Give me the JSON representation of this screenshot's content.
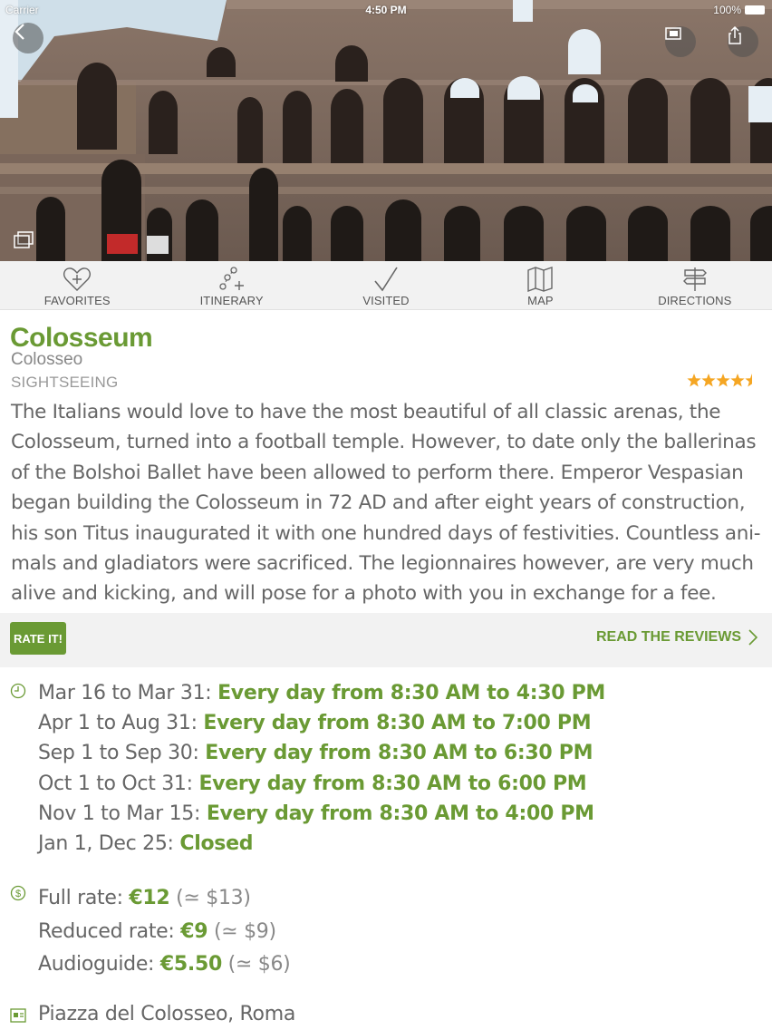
{
  "status_bar": {
    "carrier": "Carrier",
    "time": "4:50 PM",
    "battery": "100%"
  },
  "hero": {
    "image": "Colosseum photo"
  },
  "toolbar": {
    "items": [
      {
        "label": "FAVORITES",
        "icon": "heart-plus-icon"
      },
      {
        "label": "ITINERARY",
        "icon": "itinerary-icon"
      },
      {
        "label": "VISITED",
        "icon": "checkmark-icon"
      },
      {
        "label": "MAP",
        "icon": "map-icon"
      },
      {
        "label": "DIRECTIONS",
        "icon": "signpost-icon"
      }
    ]
  },
  "place": {
    "name": "Colosseum",
    "local_name": "Colosseo",
    "category": "SIGHTSEEING",
    "rating": 4.5,
    "description": "The Italians would love to have the most beautiful of all classic arenas, the Colosseum, turned into a football temple. However, to date only the ballerinas of the Bolshoi Ballet have been allowed to perform there. Emperor Vespasian began building the Colosseum in 72 AD and after eight years of construction, his son Titus inaugurated it with one hundred days of festivities. Countless ani-mals and gladiators were sacrificed. The legionnaires however, are very much alive and kicking, and will pose for a photo with you in exchange for a fee."
  },
  "rate": {
    "button": "RATE IT!",
    "reviews_link": "READ THE REVIEWS"
  },
  "hours": [
    {
      "period": "Mar 16 to Mar 31:",
      "value": "Every day from 8:30 AM to 4:30 PM"
    },
    {
      "period": "Apr 1 to Aug 31:",
      "value": "Every day from 8:30 AM to 7:00 PM"
    },
    {
      "period": "Sep 1 to Sep 30:",
      "value": "Every day from 8:30 AM to 6:30 PM"
    },
    {
      "period": "Oct 1 to Oct 31:",
      "value": "Every day from 8:30 AM to 6:00 PM"
    },
    {
      "period": "Nov 1 to Mar 15:",
      "value": "Every day from 8:30 AM to 4:00 PM"
    },
    {
      "period": "Jan 1, Dec 25:",
      "value": "Closed"
    }
  ],
  "prices": [
    {
      "label": "Full rate:",
      "value": "€12",
      "converted": "(≃ $13)"
    },
    {
      "label": "Reduced rate:",
      "value": "€9",
      "converted": "(≃ $9)"
    },
    {
      "label": "Audioguide:",
      "value": "€5.50",
      "converted": "(≃ $6)"
    }
  ],
  "address": "Piazza del Colosseo, Roma",
  "colors": {
    "accent": "#6a9a34",
    "star": "#f5a623",
    "toolbar_bg": "#f2f2f2"
  }
}
